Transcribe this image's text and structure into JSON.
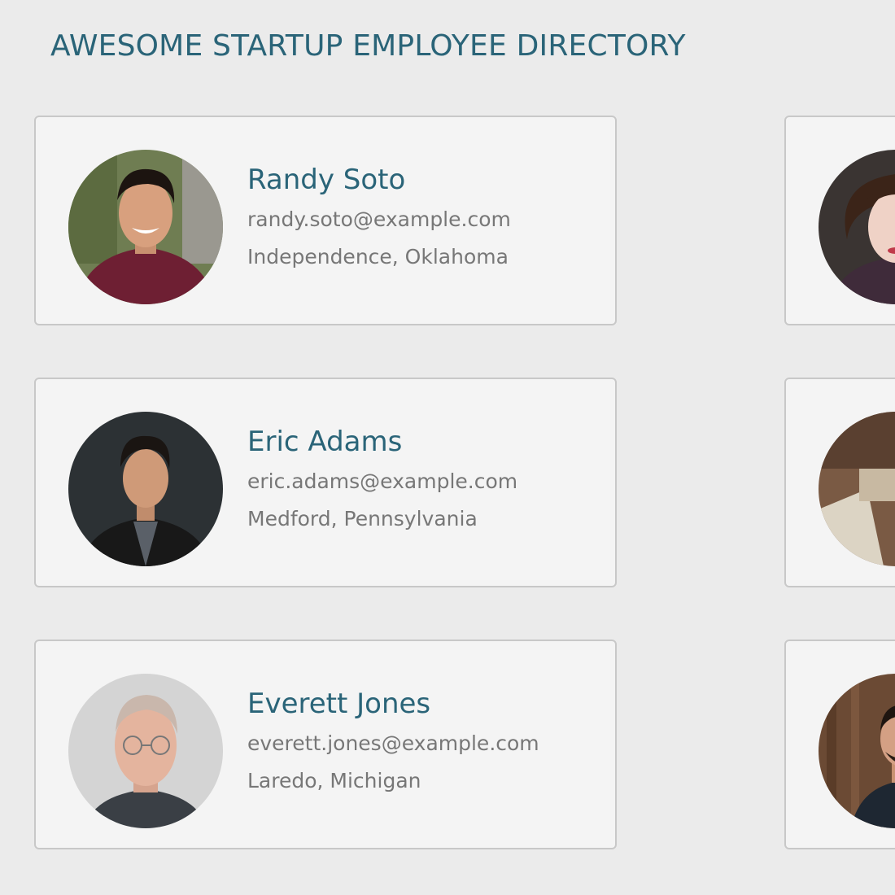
{
  "header": {
    "title": "AWESOME STARTUP EMPLOYEE DIRECTORY"
  },
  "employees": [
    {
      "name": "Randy Soto",
      "email": "randy.soto@example.com",
      "location": "Independence, Oklahoma",
      "avatar": "avatar-photo"
    },
    {
      "name": "Eric Adams",
      "email": "eric.adams@example.com",
      "location": "Medford, Pennsylvania",
      "avatar": "avatar-photo"
    },
    {
      "name": "Everett Jones",
      "email": "everett.jones@example.com",
      "location": "Laredo, Michigan",
      "avatar": "avatar-photo"
    }
  ],
  "colors": {
    "background": "#ebebeb",
    "card_background": "#f4f4f4",
    "card_border": "#c8c8c8",
    "accent": "#2a6478",
    "secondary_text": "#777777"
  }
}
